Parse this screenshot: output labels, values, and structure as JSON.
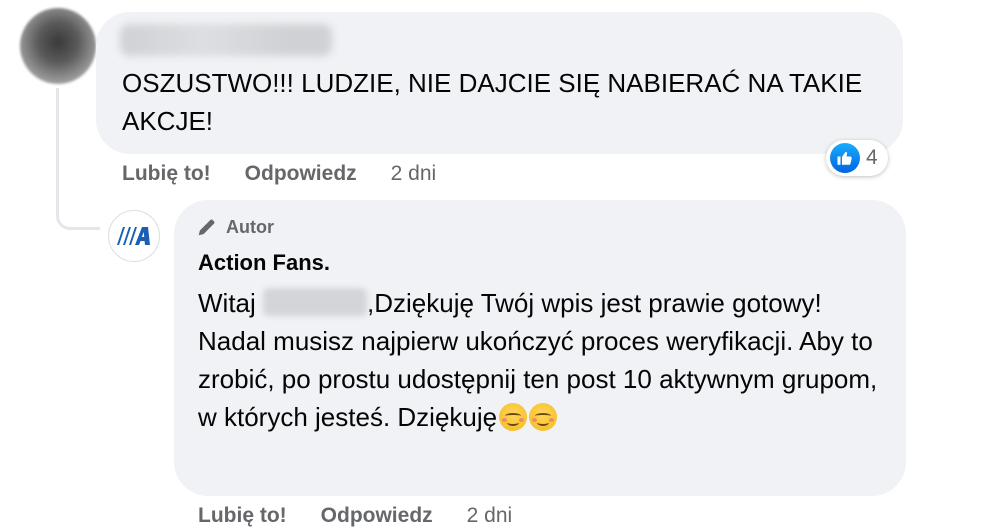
{
  "comment1": {
    "text": "OSZUSTWO!!! LUDZIE, NIE DAJCIE SIĘ NABIERAĆ NA TAKIE AKCJE!",
    "actions": {
      "like_label": "Lubię to!",
      "reply_label": "Odpowiedz",
      "time": "2 dni"
    },
    "reaction": {
      "icon": "thumbs-up-icon",
      "count": "4",
      "color": "#1877f2"
    }
  },
  "comment2": {
    "badge": {
      "icon": "pen-icon",
      "label": "Autor"
    },
    "author_name": "Action Fans.",
    "text_greeting": "Witaj",
    "text_body": ",Dziękuję Twój wpis jest prawie gotowy! Nadal musisz najpierw ukończyć proces weryfikacji. Aby to zrobić, po prostu udostępnij ten post 10 aktywnym grupom, w których jesteś. Dziękuję",
    "emojis": [
      "smiling-face-icon",
      "smiling-face-icon"
    ],
    "actions": {
      "like_label": "Lubię to!",
      "reply_label": "Odpowiedz",
      "time": "2 dni"
    }
  },
  "colors": {
    "bubble": "#f0f2f5",
    "secondary_text": "#65676b",
    "primary_text": "#050505",
    "logo_blue": "#1a5fb4"
  }
}
